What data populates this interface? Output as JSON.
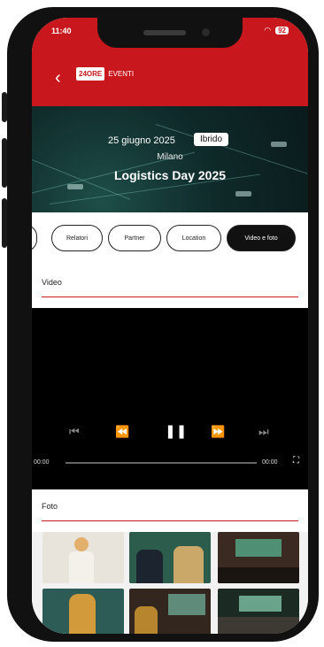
{
  "status": {
    "time": "11:40",
    "battery": "92"
  },
  "header": {
    "back_icon": "chevron-left-icon",
    "logo_mark": "24ORE",
    "logo_sub": "EVENTI"
  },
  "banner": {
    "date": "25 giugno 2025",
    "badge": "Ibrido",
    "city": "Milano",
    "title": "Logistics Day 2025"
  },
  "tabs": [
    {
      "label": ""
    },
    {
      "label": "Relatori"
    },
    {
      "label": "Partner"
    },
    {
      "label": "Location"
    },
    {
      "label": "Video e foto",
      "active": true
    }
  ],
  "video_section": {
    "title": "Video"
  },
  "player": {
    "time_current": "00:00",
    "time_total": "00:00"
  },
  "photo_section": {
    "title": "Foto"
  },
  "colors": {
    "brand": "#c8171d",
    "dark": "#111111"
  }
}
